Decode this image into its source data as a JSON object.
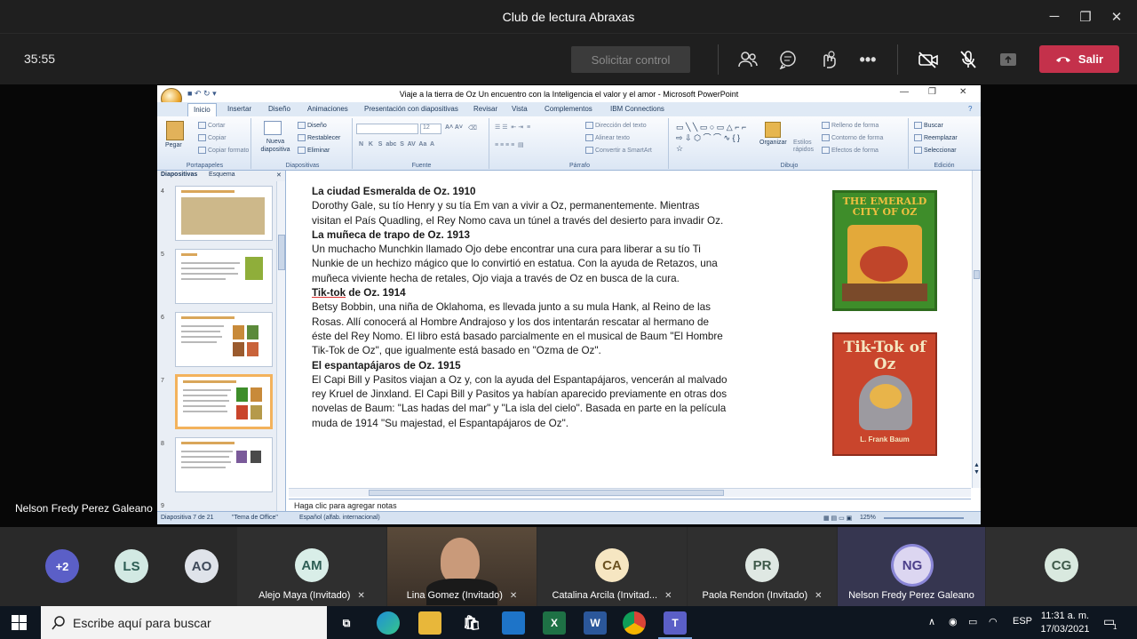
{
  "window": {
    "title": "Club de lectura Abraxas",
    "minimize": "─",
    "maximize": "❐",
    "close": "✕"
  },
  "call": {
    "elapsed": "35:55",
    "request_control": "Solicitar control",
    "leave_label": "Salir",
    "presenter_name": "Nelson Fredy Perez Galeano",
    "icons": [
      "participants-icon",
      "chat-icon",
      "reactions-icon",
      "more-icon",
      "camera-off-icon",
      "mic-off-icon",
      "share-icon"
    ]
  },
  "powerpoint": {
    "title": "Viaje a la tierra de Oz Un encuentro con la Inteligencia el valor y el amor - Microsoft PowerPoint",
    "tabs": [
      "Inicio",
      "Insertar",
      "Diseño",
      "Animaciones",
      "Presentación con diapositivas",
      "Revisar",
      "Vista",
      "Complementos",
      "IBM Connections"
    ],
    "groups": {
      "clipboard": {
        "label": "Portapapeles",
        "paste": "Pegar",
        "cut": "Cortar",
        "copy": "Copiar",
        "format_painter": "Copiar formato"
      },
      "slides": {
        "label": "Diapositivas",
        "new_slide": "Nueva diapositiva",
        "layout": "Diseño",
        "reset": "Restablecer",
        "delete": "Eliminar"
      },
      "font": {
        "label": "Fuente",
        "size": "12"
      },
      "paragraph": {
        "label": "Párrafo",
        "text_direction": "Dirección del texto",
        "align_text": "Alinear texto",
        "smartart": "Convertir a SmartArt"
      },
      "drawing": {
        "label": "Dibujo",
        "arrange": "Organizar",
        "quick_styles": "Estilos rápidos",
        "shape_fill": "Relleno de forma",
        "shape_outline": "Contorno de forma",
        "shape_effects": "Efectos de forma"
      },
      "editing": {
        "label": "Edición",
        "find": "Buscar",
        "replace": "Reemplazar",
        "select": "Seleccionar"
      }
    },
    "pane_tabs": [
      "Diapositivas",
      "Esquema"
    ],
    "thumb_numbers": [
      "4",
      "5",
      "6",
      "7",
      "8",
      "9"
    ],
    "notes_placeholder": "Haga clic para agregar notas",
    "status": {
      "slide": "Diapositiva 7 de 21",
      "theme": "\"Tema de Office\"",
      "language": "Español (alfab. internacional)",
      "zoom": "125%"
    }
  },
  "slide": {
    "s1_title": "La ciudad Esmeralda de Oz. 1910",
    "s1_body": "Dorothy Gale, su tío Henry y su tía Em van a vivir a Oz, permanentemente. Mientras visitan el País Quadling, el Rey Nomo cava un túnel a través del desierto para invadir Oz.",
    "s2_title": "La muñeca de trapo de Oz. 1913",
    "s2_body": "Un muchacho Munchkin llamado Ojo debe encontrar una cura para liberar a su tío Ti Nunkie de un hechizo mágico que lo convirtió en estatua. Con la ayuda de Retazos, una muñeca viviente hecha de retales, Ojo viaja a través de Oz en busca de la cura.",
    "s3_title_a": "Tik-tok",
    "s3_title_b": " de Oz. 1914",
    "s3_body": "Betsy Bobbin, una niña de Oklahoma, es llevada junto a su mula Hank, al Reino de las Rosas. Allí conocerá al Hombre Andrajoso y los dos intentarán rescatar al hermano de éste del Rey Nomo. El libro está basado parcialmente en el musical de Baum \"El Hombre Tik-Tok de Oz\", que igualmente está basado en \"Ozma de Oz\".",
    "s4_title": "El espantapájaros de Oz. 1915",
    "s4_body": "El Capi Bill y Pasitos viajan a Oz y, con la ayuda del Espantapájaros, vencerán al malvado rey Kruel de Jinxland. El Capi Bill y Pasitos ya habían aparecido previamente en otras dos novelas de Baum: \"Las hadas del mar\" y \"La isla del cielo\". Basada en parte en la película muda de 1914 \"Su majestad, el Espantapájaros de Oz\".",
    "cover1_title": "THE EMERALD CITY OF OZ",
    "cover2_title": "Tik-Tok of Oz",
    "cover2_author": "L. Frank Baum"
  },
  "participants": {
    "overflow": "+2",
    "bubbles": [
      {
        "initials": "LS",
        "color": "#d2e9e3"
      },
      {
        "initials": "AO",
        "color": "#dfe3ea"
      }
    ],
    "tiles": [
      {
        "initials": "AM",
        "name": "Alejo Maya (Invitado)",
        "color": "#d9eee8"
      },
      {
        "initials": "",
        "name": "Lina Gomez (Invitado)",
        "color": ""
      },
      {
        "initials": "CA",
        "name": "Catalina Arcila (Invitad...",
        "color": "#f6e6c2"
      },
      {
        "initials": "PR",
        "name": "Paola Rendon (Invitado)",
        "color": "#dfe8e3"
      },
      {
        "initials": "NG",
        "name": "Nelson Fredy Perez Galeano",
        "color": "#dcd6f1"
      },
      {
        "initials": "CG",
        "name": "",
        "color": "#d9e9df"
      }
    ]
  },
  "taskbar": {
    "search_placeholder": "Escribe aquí para buscar",
    "lang": "ESP",
    "time": "11:31 a. m.",
    "date": "17/03/2021",
    "notif": "1"
  }
}
